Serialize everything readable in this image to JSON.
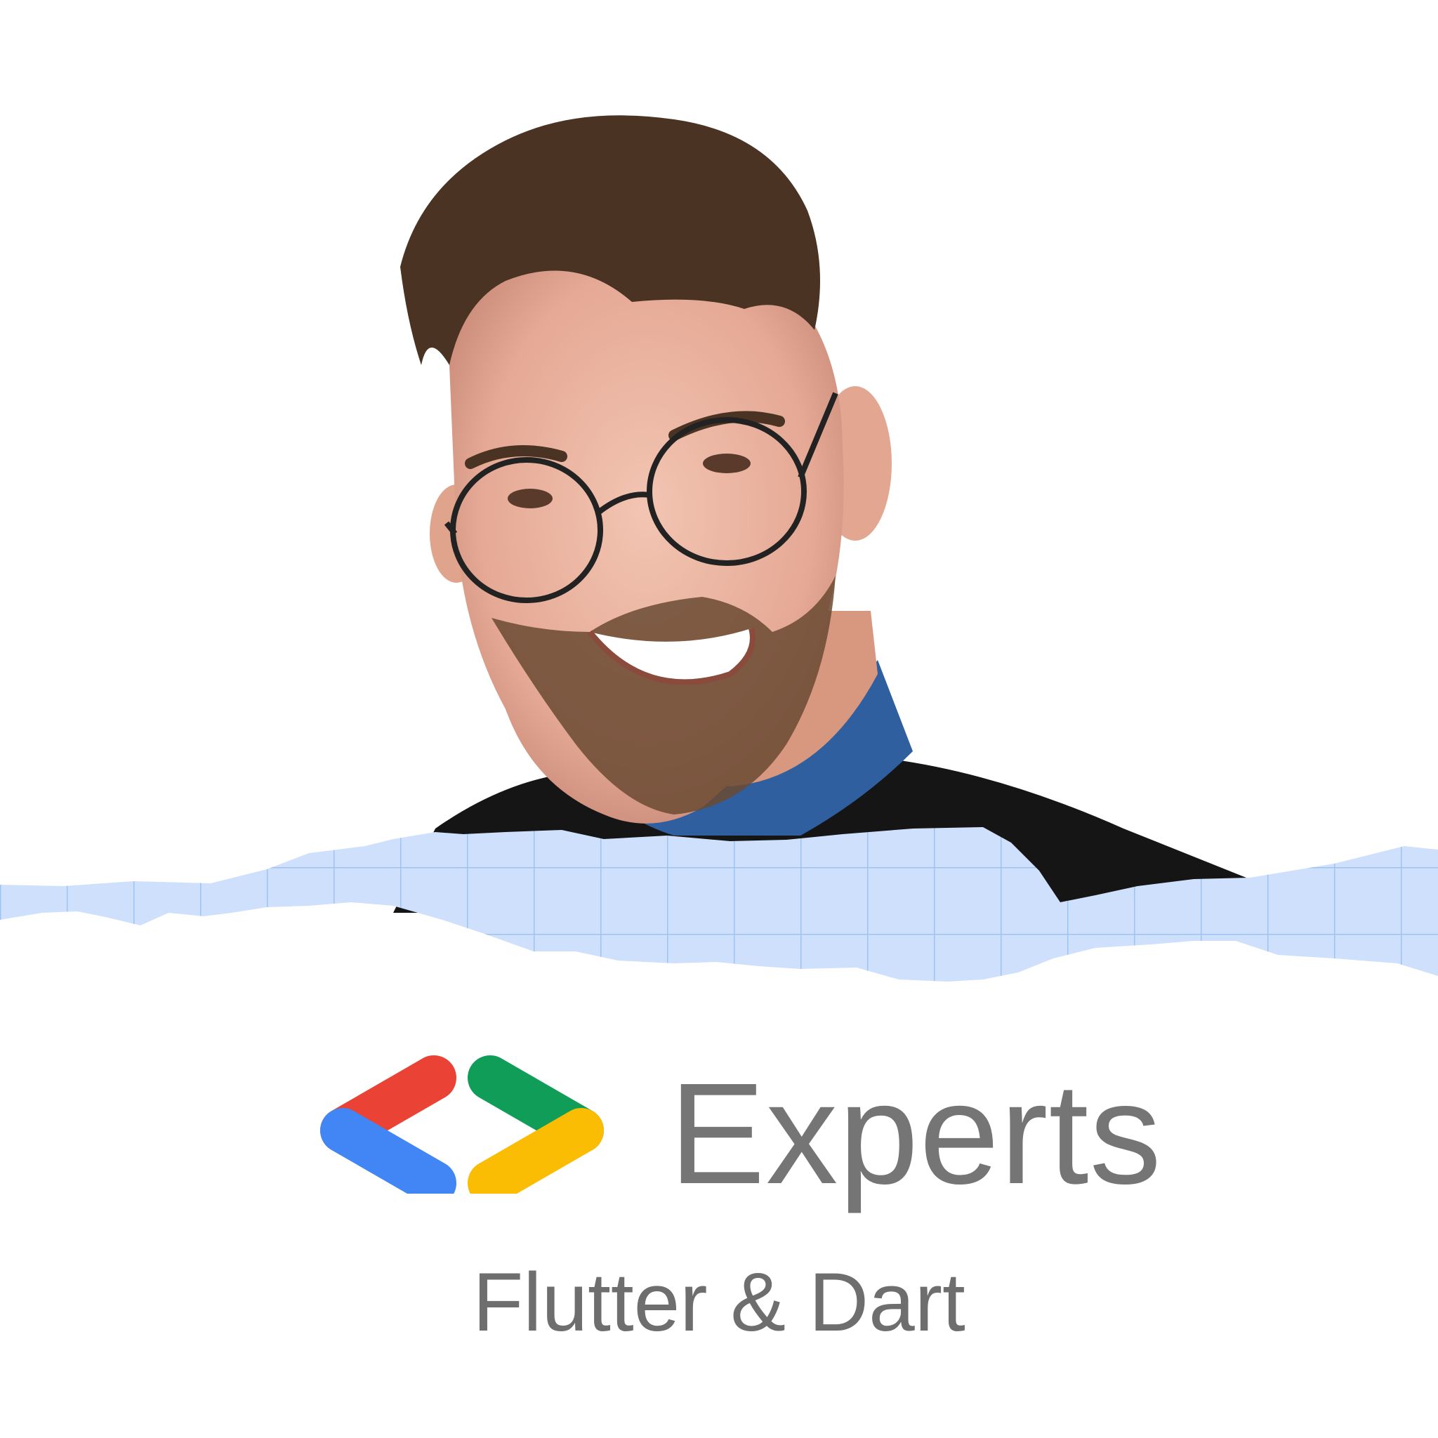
{
  "brand": {
    "wordmark": "Experts",
    "colors": {
      "red": "#EA4335",
      "blue": "#4285F4",
      "green": "#0F9D58",
      "yellow": "#FBBC04",
      "text_gray": "#757575",
      "paper_blue": "#CFE0FC",
      "grid_blue": "#9CC3F2"
    }
  },
  "specialty": "Flutter & Dart",
  "portrait": {
    "subject": "smiling man with round glasses",
    "shirt_color": "#2F5F9E",
    "sweater_color": "#151515"
  }
}
